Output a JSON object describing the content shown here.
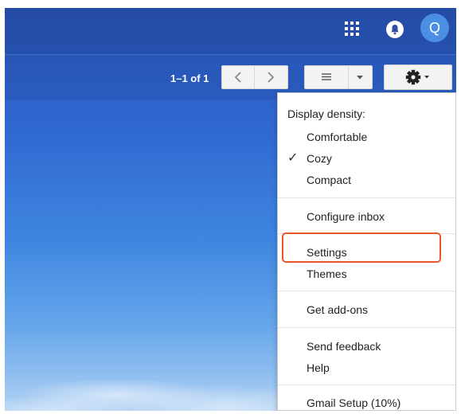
{
  "header": {
    "apps_icon": "apps-grid-icon",
    "notifications_icon": "bell-icon",
    "avatar_letter": "Q"
  },
  "toolbar": {
    "count": "1–1 of 1",
    "prev_icon": "chevron-left-icon",
    "next_icon": "chevron-right-icon",
    "view_icon": "list-view-icon",
    "view_dropdown_icon": "caret-down-icon",
    "settings_icon": "gear-icon"
  },
  "menu": {
    "heading": "Display density:",
    "density_options": [
      "Comfortable",
      "Cozy",
      "Compact"
    ],
    "selected_density": "Cozy",
    "configure": "Configure inbox",
    "settings": "Settings",
    "themes": "Themes",
    "addons": "Get add-ons",
    "feedback": "Send feedback",
    "help": "Help",
    "setup": "Gmail Setup (10%)"
  },
  "colors": {
    "accent_highlight": "#e8582a",
    "avatar": "#4a8fe3"
  }
}
